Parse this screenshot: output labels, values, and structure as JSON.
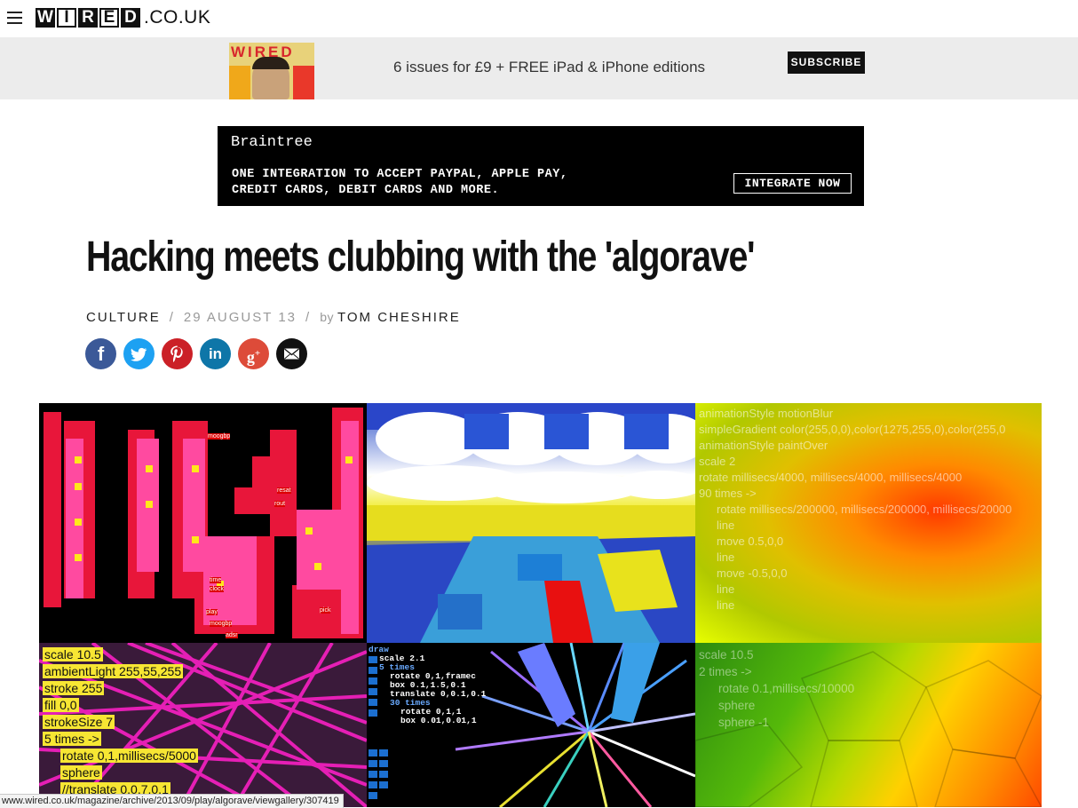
{
  "header": {
    "logo_letters": [
      "W",
      "I",
      "R",
      "E",
      "D"
    ],
    "logo_suffix": ".CO.UK"
  },
  "subscribe_banner": {
    "cover_title": "WIRED",
    "offer_text": "6 issues for £9 + FREE iPad & iPhone editions",
    "button_label": "SUBSCRIBE"
  },
  "ad": {
    "brand": "Braintree",
    "line1": "ONE INTEGRATION TO ACCEPT PAYPAL, APPLE PAY,",
    "line2": "CREDIT CARDS, DEBIT CARDS AND MORE.",
    "cta": "INTEGRATE NOW"
  },
  "article": {
    "title": "Hacking meets clubbing with the 'algorave'",
    "section": "CULTURE",
    "separator": "/",
    "date": "29 AUGUST 13",
    "by_label": "by",
    "author": "TOM CHESHIRE"
  },
  "share": [
    {
      "name": "facebook",
      "glyph": "f",
      "color": "#3b5998"
    },
    {
      "name": "twitter",
      "glyph": "t",
      "color": "#1da1f2"
    },
    {
      "name": "pinterest",
      "glyph": "p",
      "color": "#cb2027"
    },
    {
      "name": "linkedin",
      "glyph": "in",
      "color": "#0e76a8"
    },
    {
      "name": "googleplus",
      "glyph": "g+",
      "color": "#dd4b39"
    },
    {
      "name": "email",
      "glyph": "✉",
      "color": "#111111"
    }
  ],
  "gallery": {
    "panel3_code": [
      "animationStyle motionBlur",
      "simpleGradient color(255,0,0),color(1275,255,0),color(255,0",
      "animationStyle paintOver",
      "scale 2",
      "rotate millisecs/4000, millisecs/4000,  millisecs/4000",
      "90 times ->",
      "rotate millisecs/200000, millisecs/200000,  millisecs/20000",
      "line",
      "move 0.5,0,0",
      "line",
      "move -0.5,0,0",
      "line",
      "line"
    ],
    "panel4_code": [
      "scale 10.5",
      "ambientLight 255,55,255",
      "stroke 255",
      "fill 0,0",
      "strokeSize 7",
      "5 times ->",
      "rotate 0,1,millisecs/5000",
      "sphere",
      "//translate 0,0,7,0,1"
    ],
    "panel5_code": [
      "draw",
      "scale 2.1",
      "5 times",
      "rotate 0,1,framec",
      "box 0.1,1.5,0.1",
      "translate 0,0.1,0.1",
      "30 times",
      "rotate 0,1,1",
      "box 0.01,0.01,1"
    ],
    "panel6_code": [
      "scale 10.5",
      "2 times ->",
      "rotate 0.1,millisecs/10000",
      "sphere",
      "sphere -1"
    ],
    "panel1_labels": [
      "moogbp",
      "resat",
      "rout",
      "clock",
      "play",
      "time",
      "moogbp",
      "adsr",
      "pick"
    ]
  },
  "status_url": "www.wired.co.uk/magazine/archive/2013/09/play/algorave/viewgallery/307419"
}
